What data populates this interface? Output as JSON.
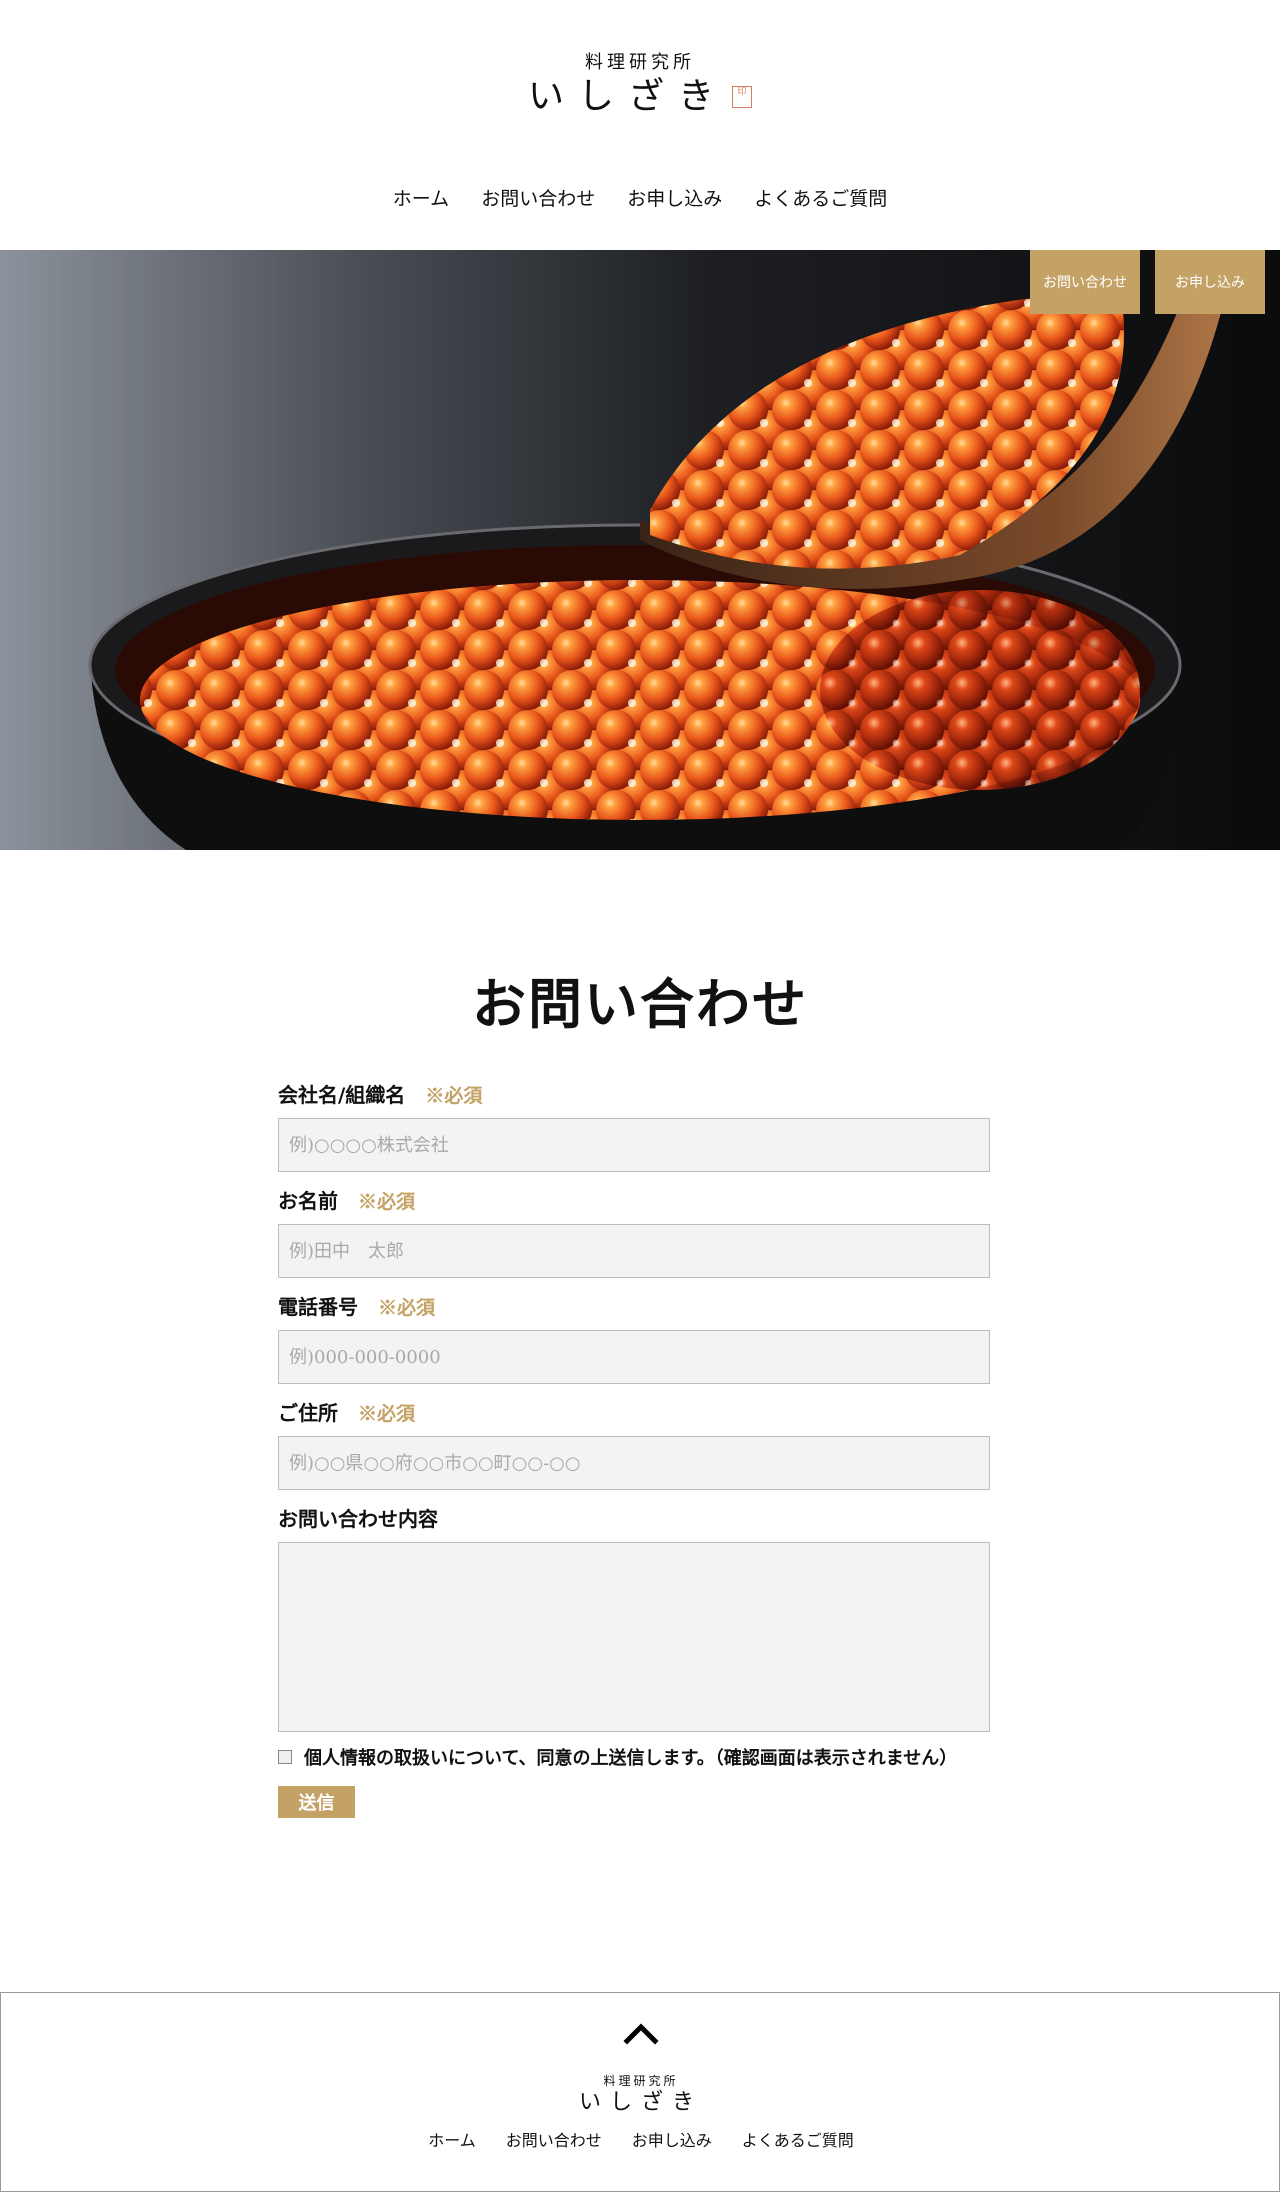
{
  "header": {
    "logo_sub": "料理研究所",
    "logo_main": "いしざき",
    "nav": [
      "ホーム",
      "お問い合わせ",
      "お申し込み",
      "よくあるご質問"
    ]
  },
  "hero": {
    "buttons": {
      "contact": "お問い合わせ",
      "apply": "お申し込み"
    }
  },
  "form": {
    "title": "お問い合わせ",
    "required_label": "※必須",
    "fields": [
      {
        "label": "会社名/組織名",
        "placeholder": "例)○○○○株式会社",
        "required": true
      },
      {
        "label": "お名前",
        "placeholder": "例)田中　太郎",
        "required": true
      },
      {
        "label": "電話番号",
        "placeholder": "例)000-000-0000",
        "required": true
      },
      {
        "label": "ご住所",
        "placeholder": "例)○○県○○府○○市○○町○○-○○",
        "required": true
      },
      {
        "label": "お問い合わせ内容",
        "placeholder": "",
        "required": false
      }
    ],
    "consent": "個人情報の取扱いについて、同意の上送信します。（確認画面は表示されません）",
    "submit": "送信"
  },
  "footer": {
    "logo_sub": "料理研究所",
    "logo_main": "いしざき",
    "nav": [
      "ホーム",
      "お問い合わせ",
      "お申し込み",
      "よくあるご質問"
    ]
  },
  "colors": {
    "accent": "#c4a265",
    "ikura": "#e8541a",
    "bowl": "#0e0e0f"
  }
}
